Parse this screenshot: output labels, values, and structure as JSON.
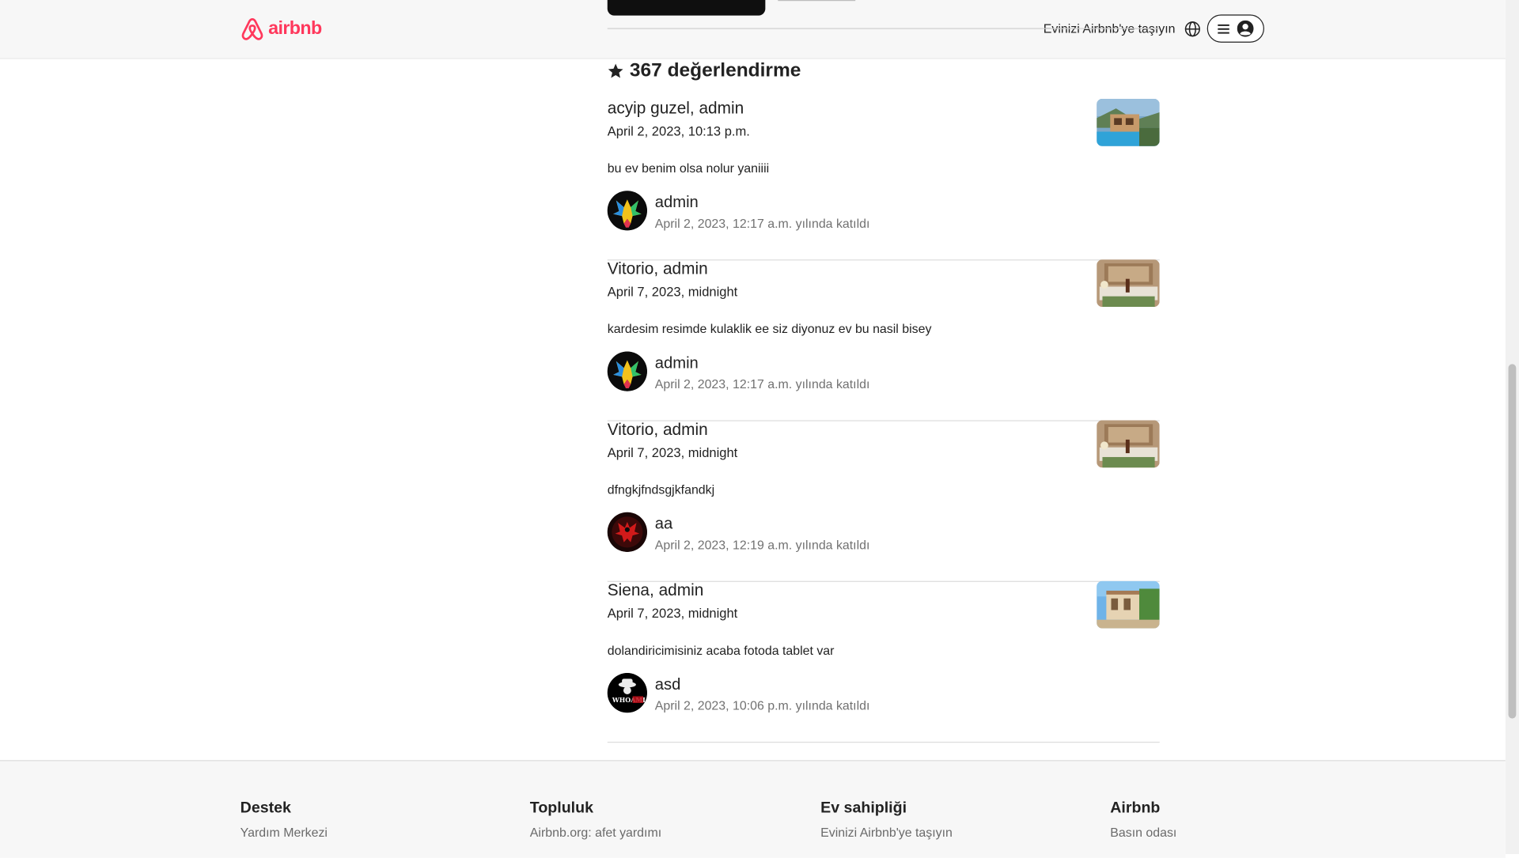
{
  "header": {
    "logo_text": "airbnb",
    "host_link": "Evinizi Airbnb'ye taşıyın",
    "brand_color": "#FF385C"
  },
  "reviews": {
    "title": "367 değerlendirme",
    "items": [
      {
        "heading": "acyip guzel, admin",
        "date": "April 2, 2023, 10:13 p.m.",
        "text": "bu ev benim olsa nolur yaniiii",
        "user_name": "admin",
        "user_joined": "April 2, 2023, 12:17 a.m. yılında katıldı",
        "thumb": "pool-house",
        "avatar": "rainbow-eagle"
      },
      {
        "heading": "Vitorio, admin",
        "date": "April 7, 2023, midnight",
        "text": "kardesim resimde kulaklik ee siz diyonuz ev bu nasil bisey",
        "user_name": "admin",
        "user_joined": "April 2, 2023, 12:17 a.m. yılında katıldı",
        "thumb": "bedroom",
        "avatar": "rainbow-eagle"
      },
      {
        "heading": "Vitorio, admin",
        "date": "April 7, 2023, midnight",
        "text": "dfngkjfndsgjkfandkj",
        "user_name": "aa",
        "user_joined": "April 2, 2023, 12:19 a.m. yılında katıldı",
        "thumb": "bedroom",
        "avatar": "red-eagle"
      },
      {
        "heading": "Siena, admin",
        "date": "April 7, 2023, midnight",
        "text": "dolandiricimisiniz acaba fotoda tablet var",
        "user_name": "asd",
        "user_joined": "April 2, 2023, 10:06 p.m. yılında katıldı",
        "thumb": "villa",
        "avatar": "whoami-logo"
      }
    ]
  },
  "footer": {
    "columns": [
      {
        "title": "Destek",
        "link": "Yardım Merkezi"
      },
      {
        "title": "Topluluk",
        "link": "Airbnb.org: afet yardımı"
      },
      {
        "title": "Ev sahipliği",
        "link": "Evinizi Airbnb'ye taşıyın"
      },
      {
        "title": "Airbnb",
        "link": "Basın odası"
      }
    ]
  }
}
